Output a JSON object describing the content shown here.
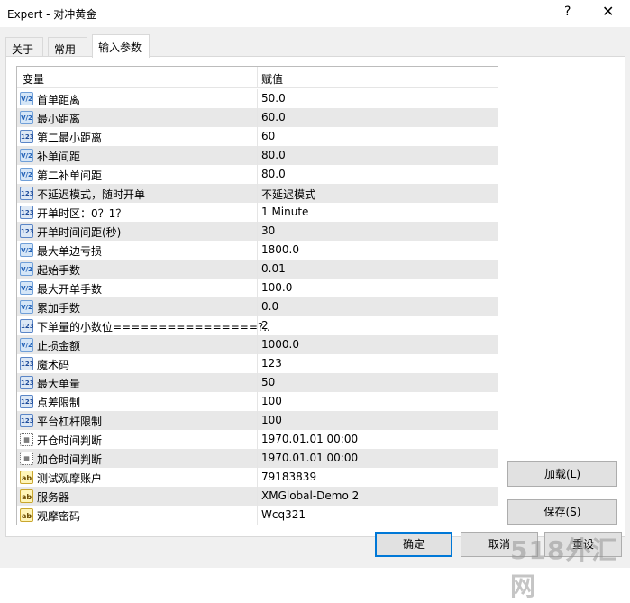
{
  "window": {
    "title": "Expert - 对冲黄金",
    "help": "?",
    "close": "✕"
  },
  "tabs": [
    {
      "label": "关于"
    },
    {
      "label": "常用"
    },
    {
      "label": "输入参数"
    }
  ],
  "grid": {
    "headers": {
      "variable": "变量",
      "value": "赋值"
    },
    "rows": [
      {
        "type": "double",
        "icon": "V/2",
        "name": "首单距离",
        "value": "50.0"
      },
      {
        "type": "double",
        "icon": "V/2",
        "name": "最小距离",
        "value": "60.0"
      },
      {
        "type": "int",
        "icon": "123",
        "name": "第二最小距离",
        "value": "60"
      },
      {
        "type": "double",
        "icon": "V/2",
        "name": "补单间距",
        "value": "80.0"
      },
      {
        "type": "double",
        "icon": "V/2",
        "name": "第二补单间距",
        "value": "80.0"
      },
      {
        "type": "int",
        "icon": "123",
        "name": "不延迟模式，随时开单",
        "value": "不延迟模式"
      },
      {
        "type": "int",
        "icon": "123",
        "name": "开单时区：0？1？",
        "value": "1 Minute"
      },
      {
        "type": "int",
        "icon": "123",
        "name": "开单时间间距(秒)",
        "value": "30"
      },
      {
        "type": "double",
        "icon": "V/2",
        "name": "最大单边亏损",
        "value": "1800.0"
      },
      {
        "type": "double",
        "icon": "V/2",
        "name": "起始手数",
        "value": "0.01"
      },
      {
        "type": "double",
        "icon": "V/2",
        "name": "最大开单手数",
        "value": "100.0"
      },
      {
        "type": "double",
        "icon": "V/2",
        "name": "累加手数",
        "value": "0.0"
      },
      {
        "type": "int",
        "icon": "123",
        "name": "下单量的小数位================?..",
        "value": "2"
      },
      {
        "type": "double",
        "icon": "V/2",
        "name": "止损金额",
        "value": "1000.0"
      },
      {
        "type": "int",
        "icon": "123",
        "name": "魔术码",
        "value": "123"
      },
      {
        "type": "int",
        "icon": "123",
        "name": "最大单量",
        "value": "50"
      },
      {
        "type": "int",
        "icon": "123",
        "name": "点差限制",
        "value": "100"
      },
      {
        "type": "int",
        "icon": "123",
        "name": "平台杠杆限制",
        "value": "100"
      },
      {
        "type": "datetime",
        "icon": "▦",
        "name": "开仓时间判断",
        "value": "1970.01.01 00:00"
      },
      {
        "type": "datetime",
        "icon": "▦",
        "name": "加仓时间判断",
        "value": "1970.01.01 00:00"
      },
      {
        "type": "string",
        "icon": "ab",
        "name": "测试观摩账户",
        "value": "79183839"
      },
      {
        "type": "string",
        "icon": "ab",
        "name": "服务器",
        "value": "XMGlobal-Demo 2"
      },
      {
        "type": "string",
        "icon": "ab",
        "name": "观摩密码",
        "value": "Wcq321"
      }
    ]
  },
  "buttons": {
    "load": "加载(L)",
    "save": "保存(S)",
    "ok": "确定",
    "cancel": "取消",
    "reset": "重设"
  },
  "watermark": "518外汇网"
}
